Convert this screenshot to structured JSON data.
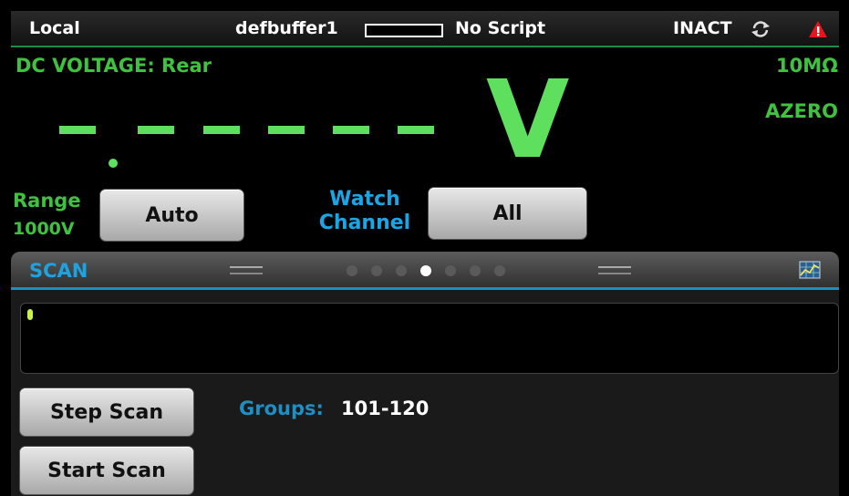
{
  "status_bar": {
    "mode": "Local",
    "buffer": "defbuffer1",
    "script": "No Script",
    "trigger_state": "INACT"
  },
  "measure": {
    "function": "DC VOLTAGE: Rear",
    "impedance": "10MΩ",
    "autozero": "AZERO",
    "reading_unit": "V",
    "range_label": "Range",
    "range_value": "1000V",
    "range_button": "Auto",
    "watch_label_line1": "Watch",
    "watch_label_line2": "Channel",
    "watch_button": "All"
  },
  "panel": {
    "title": "SCAN",
    "pages": 7,
    "active_page": 4,
    "step_scan_label": "Step Scan",
    "start_scan_label": "Start Scan",
    "groups_label": "Groups:",
    "groups_value": "101-120"
  },
  "colors": {
    "reading_green": "#5ee05e",
    "label_green": "#3fc23f",
    "accent_blue": "#1fa3e0"
  }
}
